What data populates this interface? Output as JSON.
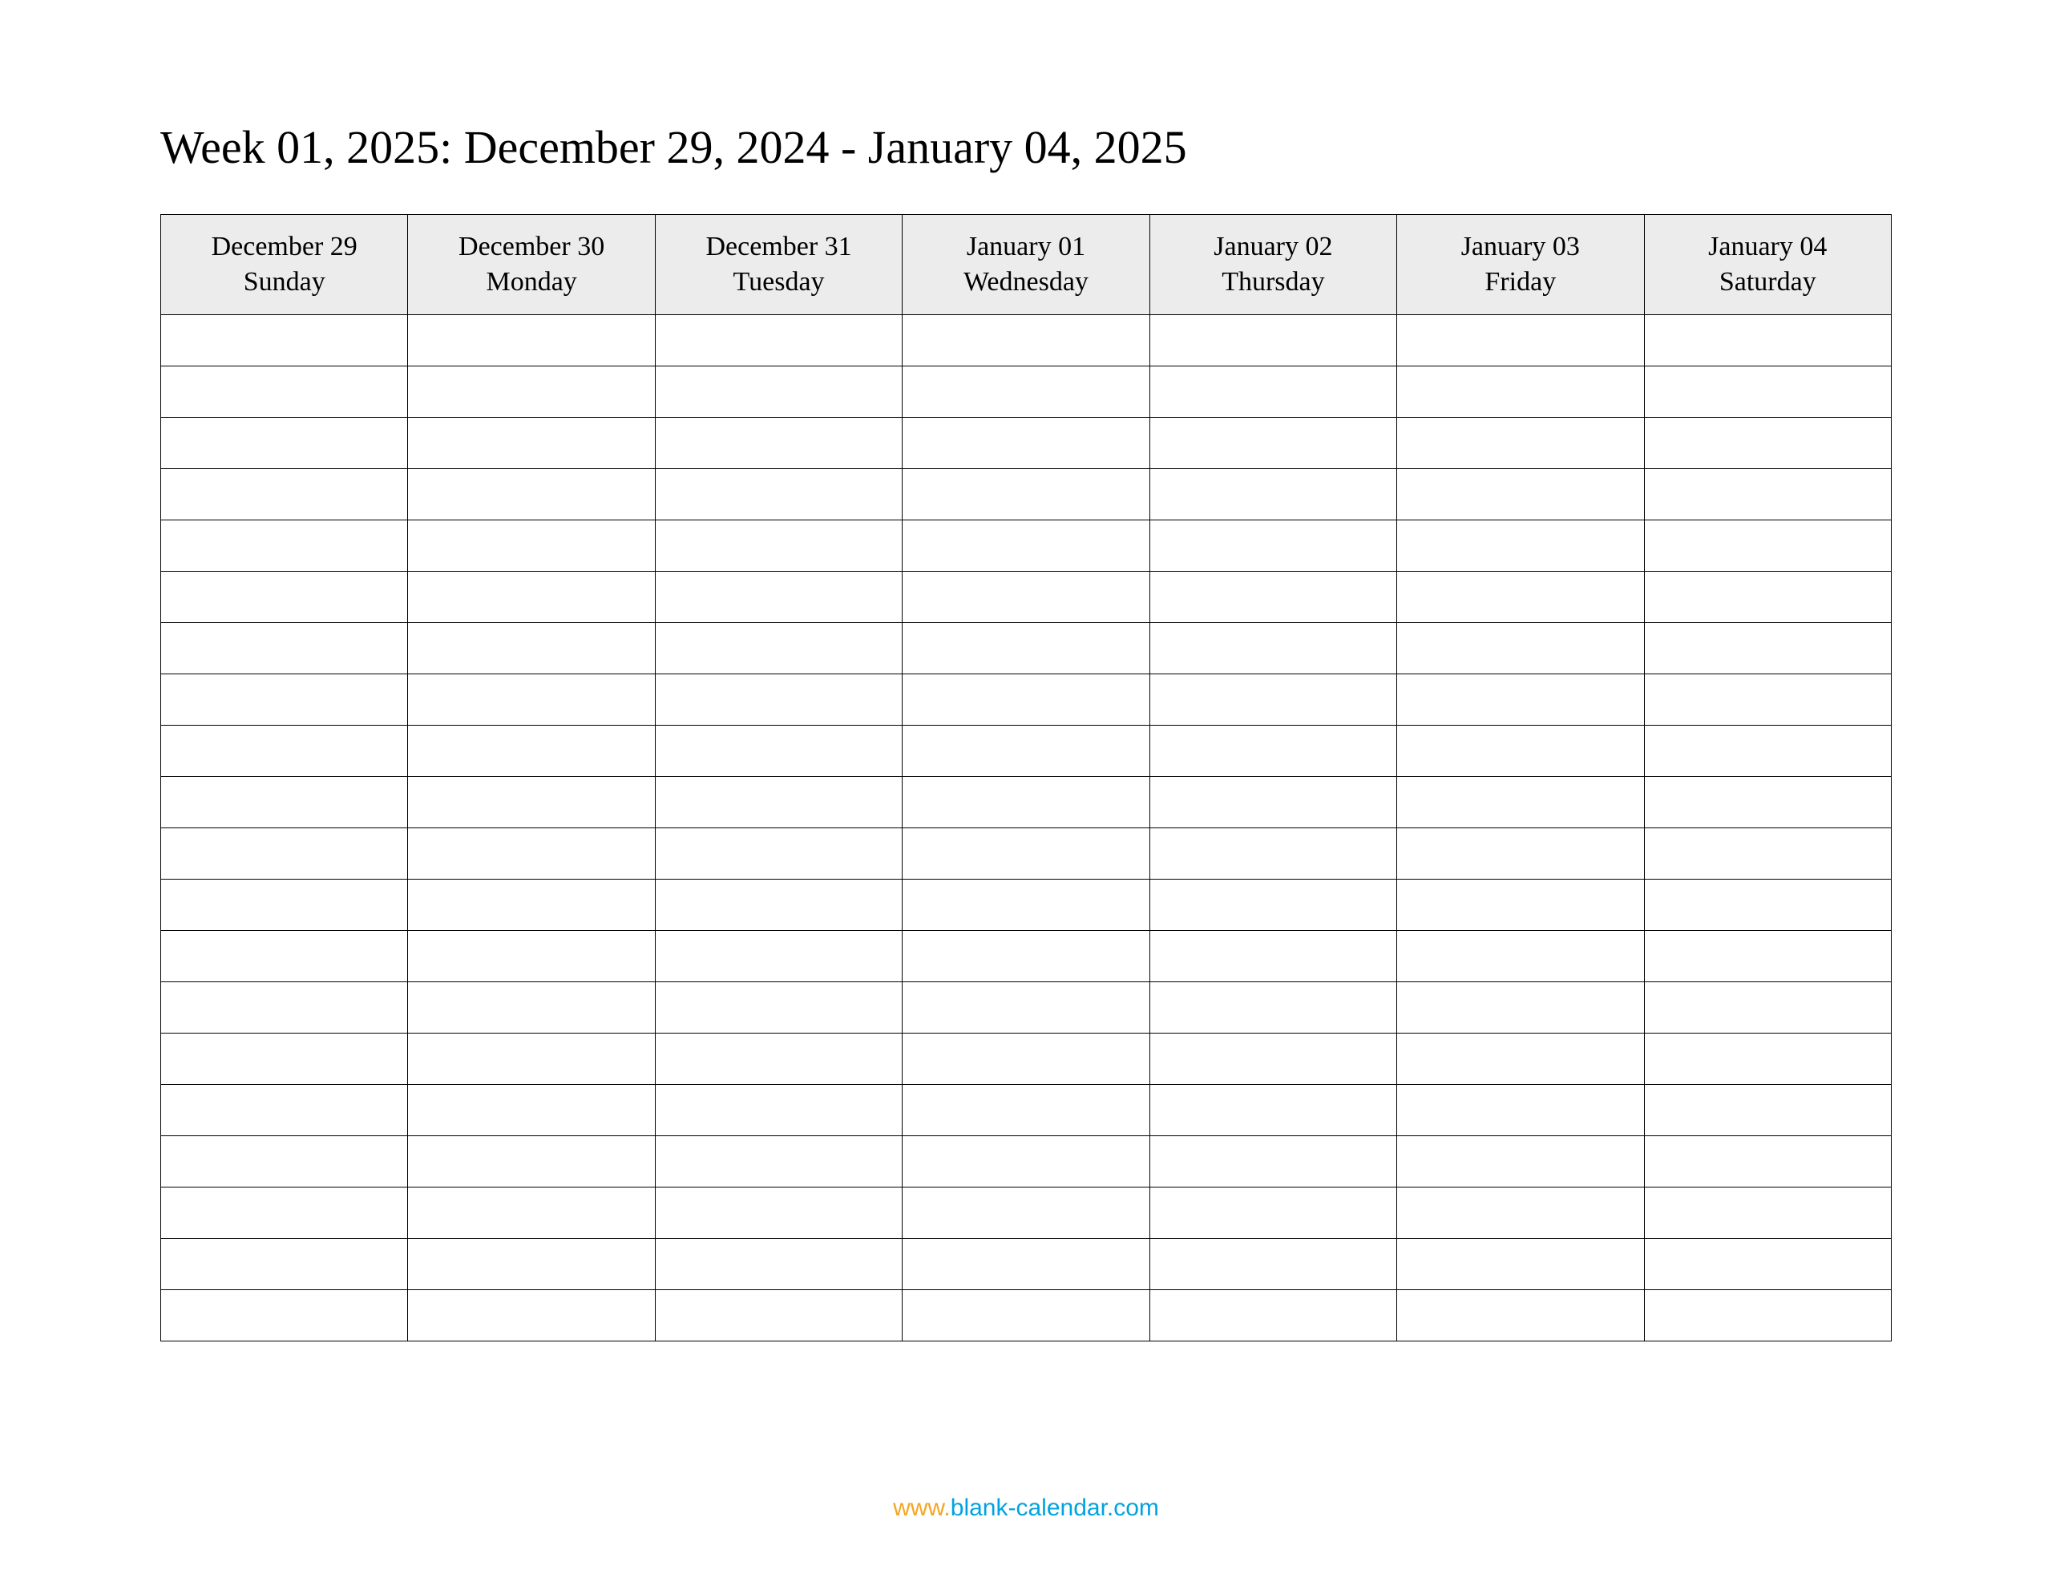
{
  "title": "Week 01, 2025: December 29, 2024 - January 04, 2025",
  "columns": [
    {
      "date": "December 29",
      "day": "Sunday"
    },
    {
      "date": "December 30",
      "day": "Monday"
    },
    {
      "date": "December 31",
      "day": "Tuesday"
    },
    {
      "date": "January 01",
      "day": "Wednesday"
    },
    {
      "date": "January 02",
      "day": "Thursday"
    },
    {
      "date": "January 03",
      "day": "Friday"
    },
    {
      "date": "January 04",
      "day": "Saturday"
    }
  ],
  "blank_rows": 20,
  "footer": {
    "prefix": "www.",
    "link": "blank-calendar.com"
  }
}
